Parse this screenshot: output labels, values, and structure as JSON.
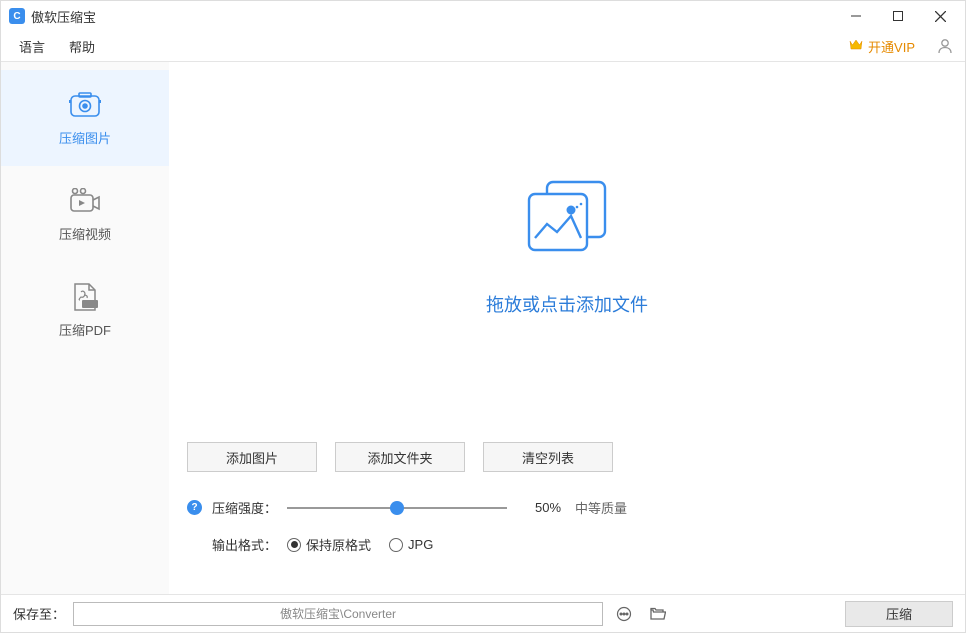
{
  "app": {
    "title": "傲软压缩宝"
  },
  "menu": {
    "language": "语言",
    "help": "帮助",
    "vip": "开通VIP"
  },
  "sidebar": {
    "items": [
      {
        "label": "压缩图片"
      },
      {
        "label": "压缩视频"
      },
      {
        "label": "压缩PDF"
      }
    ]
  },
  "dropzone": {
    "text": "拖放或点击添加文件"
  },
  "buttons": {
    "add_image": "添加图片",
    "add_folder": "添加文件夹",
    "clear_list": "清空列表"
  },
  "settings": {
    "strength_label": "压缩强度：",
    "strength_percent": "50%",
    "strength_quality": "中等质量",
    "output_label": "输出格式：",
    "opt_keep": "保持原格式",
    "opt_jpg": "JPG"
  },
  "footer": {
    "save_to_label": "保存至：",
    "path": "傲软压缩宝\\Converter",
    "compress": "压缩"
  }
}
